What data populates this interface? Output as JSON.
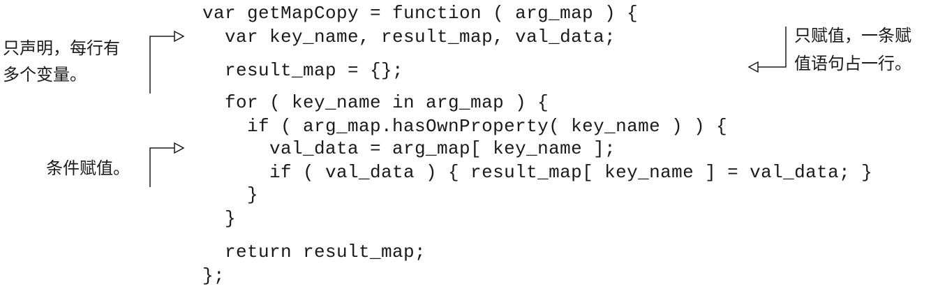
{
  "code": [
    "var getMapCopy = function ( arg_map ) {",
    "  var key_name, result_map, val_data;",
    "  result_map = {};",
    "  for ( key_name in arg_map ) {",
    "    if ( arg_map.hasOwnProperty( key_name ) ) {",
    "      val_data = arg_map[ key_name ];",
    "      if ( val_data ) { result_map[ key_name ] = val_data; }",
    "    }",
    "  }",
    "  return result_map;",
    "};"
  ],
  "annotations": {
    "declare": {
      "line1": "只声明，每行有",
      "line2": "多个变量。"
    },
    "assign": {
      "line1": "只赋值，一条赋",
      "line2": "值语句占一行。"
    },
    "conditional": {
      "line1": "条件赋值。"
    }
  }
}
